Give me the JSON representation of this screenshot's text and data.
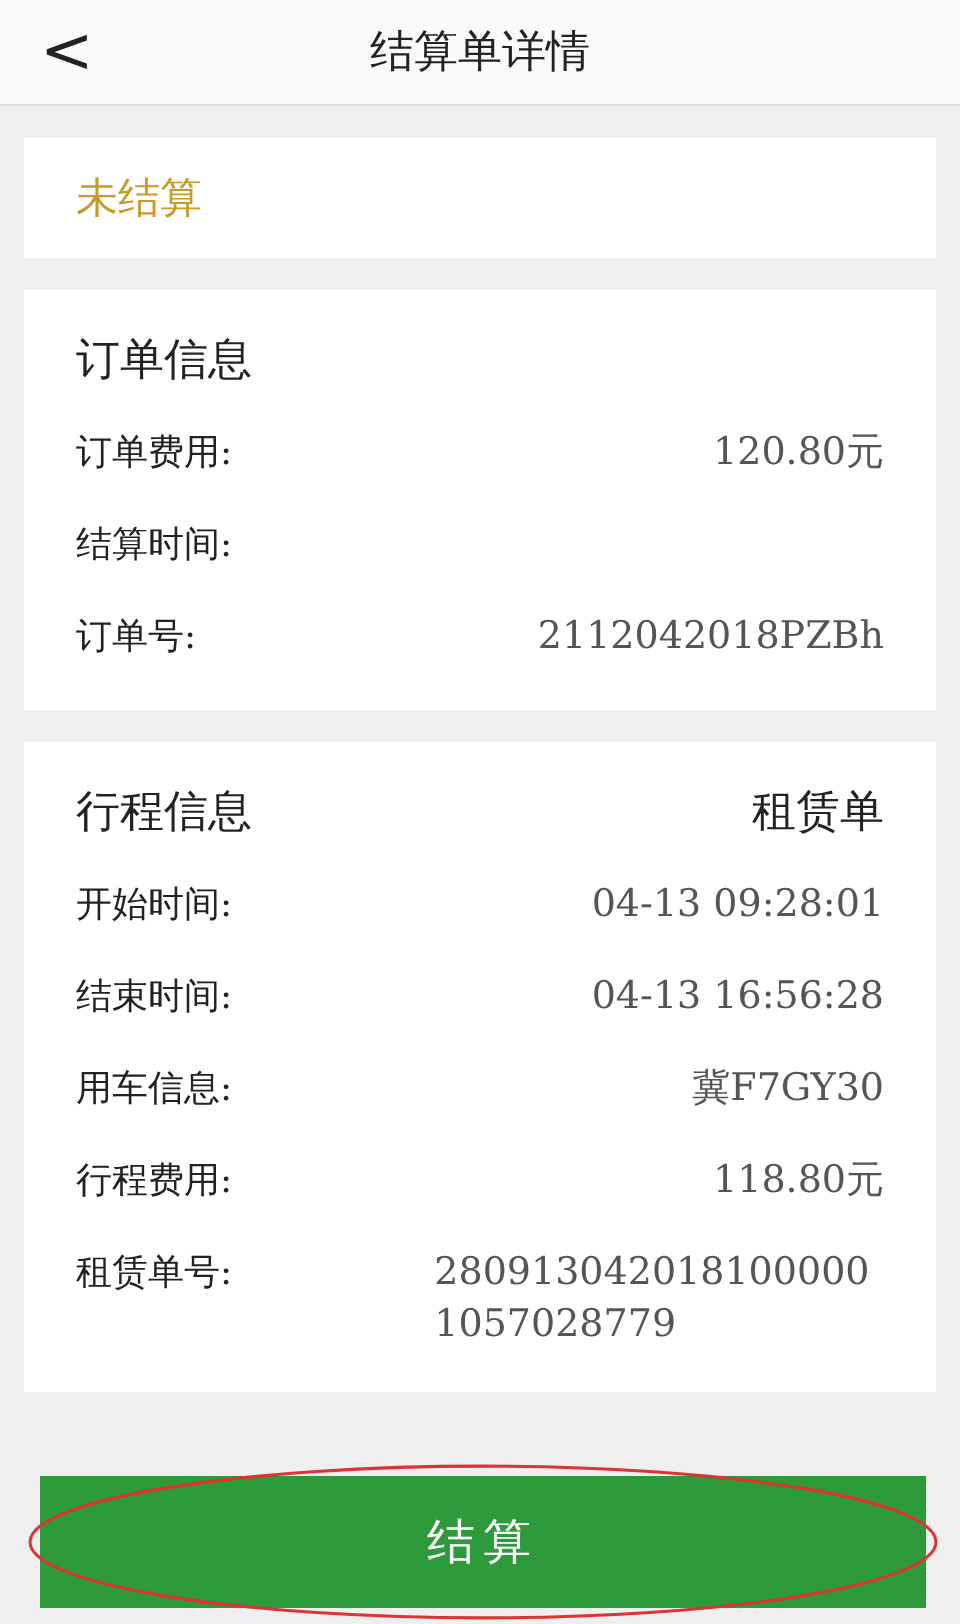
{
  "header": {
    "back": "<",
    "title": "结算单详情"
  },
  "status": "未结算",
  "order_info": {
    "title": "订单信息",
    "rows": [
      {
        "label": "订单费用:",
        "value": "120.80元"
      },
      {
        "label": "结算时间:"
      },
      {
        "label": "订单号:",
        "value": "2112042018PZBh"
      }
    ]
  },
  "trip_info": {
    "title": "行程信息",
    "type": "租赁单",
    "rows": [
      {
        "label": "开始时间:",
        "value": "04-13 09:28:01"
      },
      {
        "label": "结束时间:",
        "value": "04-13 16:56:28"
      },
      {
        "label": "用车信息:",
        "value": "冀F7GY30"
      },
      {
        "label": "行程费用:",
        "value": "118.80元"
      },
      {
        "label": "租赁单号:",
        "value": "2809130420181000001057028779"
      }
    ]
  },
  "button": "结算"
}
